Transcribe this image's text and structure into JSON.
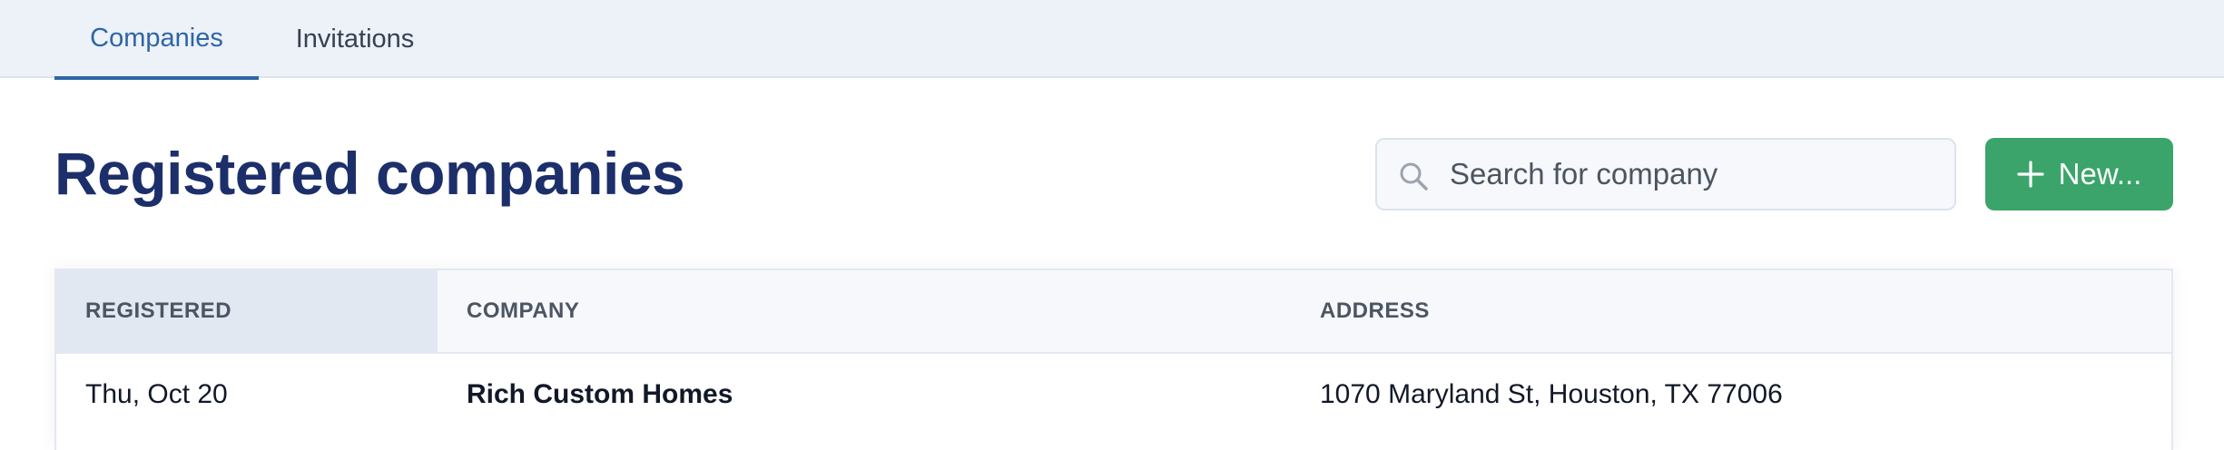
{
  "tabs": [
    {
      "label": "Companies",
      "active": true
    },
    {
      "label": "Invitations",
      "active": false
    }
  ],
  "page_title": "Registered companies",
  "search": {
    "placeholder": "Search for company",
    "value": "",
    "icon": "search-icon"
  },
  "new_button": {
    "label": "New...",
    "icon": "plus-icon",
    "color": "#3ba46a"
  },
  "table": {
    "columns": [
      "REGISTERED",
      "COMPANY",
      "ADDRESS"
    ],
    "rows": [
      {
        "registered": "Thu, Oct 20",
        "company": "Rich Custom Homes",
        "address": "1070 Maryland St, Houston, TX 77006"
      }
    ]
  },
  "colors": {
    "accent": "#2d65a5",
    "title": "#1c2f6b",
    "tabbar_bg": "#edf1f8"
  }
}
